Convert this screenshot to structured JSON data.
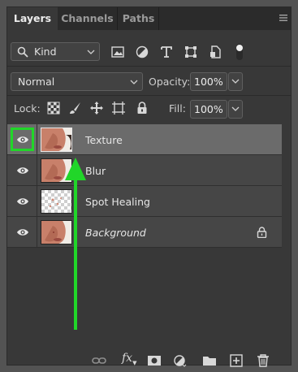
{
  "tabs": [
    {
      "label": "Layers",
      "active": true
    },
    {
      "label": "Channels",
      "active": false
    },
    {
      "label": "Paths",
      "active": false
    }
  ],
  "filter": {
    "label": "Kind",
    "icons": [
      "image-filter-icon",
      "adjustment-filter-icon",
      "type-filter-icon",
      "shape-filter-icon",
      "smart-object-filter-icon",
      "filter-toggle-icon"
    ]
  },
  "blend": {
    "mode": "Normal",
    "opacity_label": "Opacity:",
    "opacity_value": "100%"
  },
  "lock": {
    "label": "Lock:",
    "fill_label": "Fill:",
    "fill_value": "100%"
  },
  "layers": [
    {
      "name": "Texture",
      "visible": true,
      "selected": true,
      "italic": false,
      "locked": false
    },
    {
      "name": "Blur",
      "visible": true,
      "selected": false,
      "italic": false,
      "locked": false
    },
    {
      "name": "Spot Healing",
      "visible": true,
      "selected": false,
      "italic": false,
      "locked": false
    },
    {
      "name": "Background",
      "visible": true,
      "selected": false,
      "italic": true,
      "locked": true
    }
  ],
  "footer_icons": [
    "link-layers-icon",
    "fx-icon",
    "layer-mask-icon",
    "adjustment-layer-icon",
    "new-group-icon",
    "new-layer-icon",
    "delete-layer-icon"
  ],
  "fx_label": "fx",
  "colors": {
    "highlight": "#21d629",
    "panel": "#383838",
    "selected_row": "#6b6b6b"
  }
}
